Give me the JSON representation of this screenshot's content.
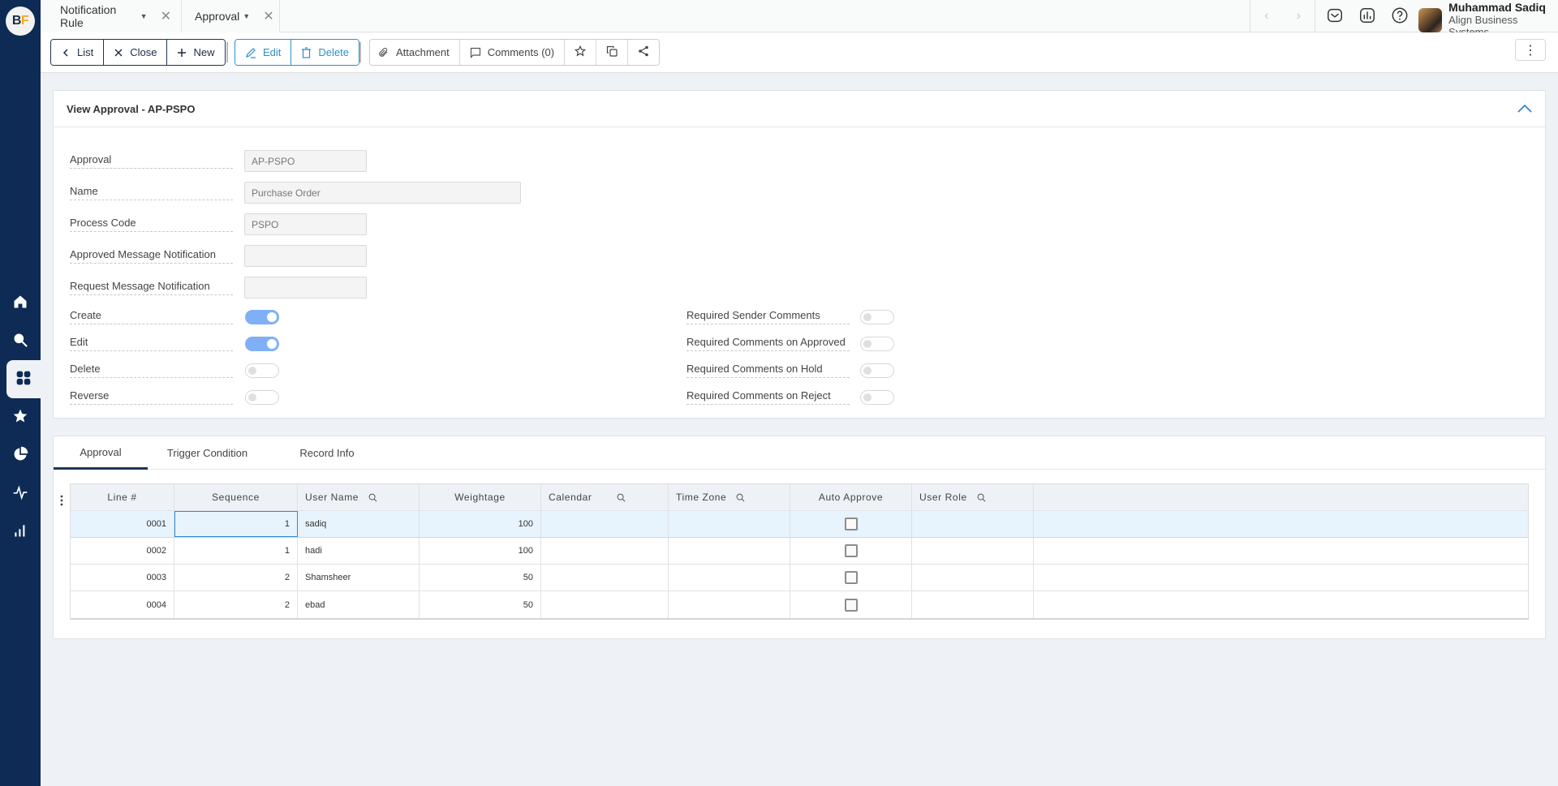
{
  "app": {
    "logo_b": "B",
    "logo_f": "F"
  },
  "sidebar": {
    "items": [
      {
        "name": "home",
        "icon": "home-icon",
        "active": false
      },
      {
        "name": "search",
        "icon": "search-icon",
        "active": false
      },
      {
        "name": "apps",
        "icon": "grid-icon",
        "active": true
      },
      {
        "name": "favorites",
        "icon": "star-icon",
        "active": false
      },
      {
        "name": "reports",
        "icon": "pie-chart-icon",
        "active": false
      },
      {
        "name": "activity",
        "icon": "pulse-icon",
        "active": false
      },
      {
        "name": "analytics",
        "icon": "bar-chart-icon",
        "active": false
      }
    ]
  },
  "topbar": {
    "tabs": [
      {
        "label": "Notification Rule"
      },
      {
        "label": "Approval"
      }
    ],
    "icons": [
      "mail-icon",
      "chart-icon",
      "help-icon"
    ],
    "user": {
      "name": "Muhammad Sadiq",
      "org": "Align Business Systems"
    }
  },
  "toolbar": {
    "list": "List",
    "close": "Close",
    "new": "New",
    "edit": "Edit",
    "delete": "Delete",
    "attachment": "Attachment",
    "comments": "Comments (0)"
  },
  "form": {
    "title": "View Approval - AP-PSPO",
    "fields": [
      {
        "label": "Approval",
        "value": "AP-PSPO"
      },
      {
        "label": "Name",
        "value": "Purchase Order"
      },
      {
        "label": "Process Code",
        "value": "PSPO"
      },
      {
        "label": "Approved Message Notification",
        "value": ""
      },
      {
        "label": "Request Message Notification",
        "value": ""
      }
    ],
    "toggles_left": [
      {
        "label": "Create",
        "on": true
      },
      {
        "label": "Edit",
        "on": true
      },
      {
        "label": "Delete",
        "on": false
      },
      {
        "label": "Reverse",
        "on": false
      }
    ],
    "toggles_right": [
      {
        "label": "Required Sender Comments",
        "on": false
      },
      {
        "label": "Required Comments on Approved",
        "on": false
      },
      {
        "label": "Required Comments on Hold",
        "on": false
      },
      {
        "label": "Required Comments on Reject",
        "on": false
      }
    ]
  },
  "detail": {
    "tabs": [
      {
        "label": "Approval",
        "active": true
      },
      {
        "label": "Trigger Condition",
        "active": false
      },
      {
        "label": "Record Info",
        "active": false
      }
    ],
    "columns": [
      "Line #",
      "Sequence",
      "User Name",
      "Weightage",
      "Calendar",
      "Time Zone",
      "Auto Approve",
      "User Role",
      ""
    ],
    "rows": [
      {
        "line": "0001",
        "sequence": "1",
        "user": "sadiq",
        "weightage": "100",
        "calendar": "",
        "timezone": "",
        "auto_approve": false,
        "role": ""
      },
      {
        "line": "0002",
        "sequence": "1",
        "user": "hadi",
        "weightage": "100",
        "calendar": "",
        "timezone": "",
        "auto_approve": false,
        "role": ""
      },
      {
        "line": "0003",
        "sequence": "2",
        "user": "Shamsheer",
        "weightage": "50",
        "calendar": "",
        "timezone": "",
        "auto_approve": false,
        "role": ""
      },
      {
        "line": "0004",
        "sequence": "2",
        "user": "ebad",
        "weightage": "50",
        "calendar": "",
        "timezone": "",
        "auto_approve": false,
        "role": ""
      }
    ]
  },
  "colors": {
    "sidebar_bg": "#0d2b55",
    "accent_blue": "#2f8fc9",
    "toggle_on": "#7fb0f6",
    "selected_row": "#e7f3fd"
  }
}
